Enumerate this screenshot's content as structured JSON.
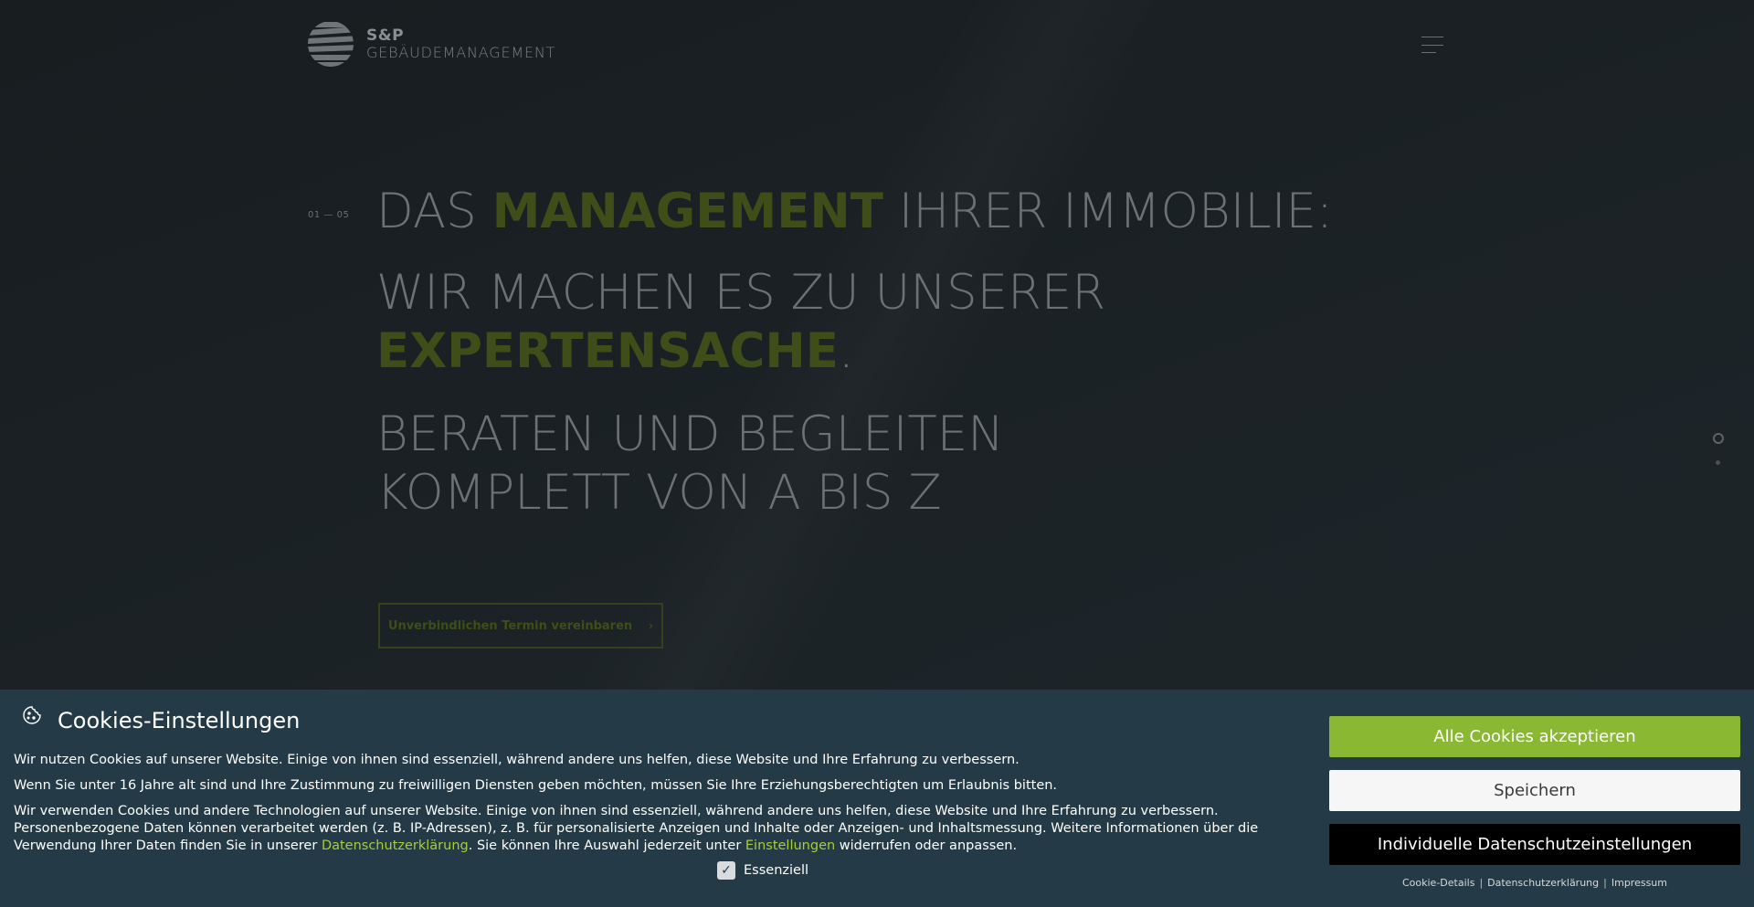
{
  "header": {
    "logo_line1": "S&P",
    "logo_line2": "GEBÄUDEMANAGEMENT",
    "menu_icon": "hamburger-icon"
  },
  "slide": {
    "counter": "01 — 05",
    "line1_pre": "DAS ",
    "line1_accent": "MANAGEMENT",
    "line1_post": " IHRER IMMOBILIE:",
    "line2": "WIR MACHEN ES ZU UNSERER",
    "line3_accent": "EXPERTENSACHE",
    "line3_post": ".",
    "line4": "BERATEN UND BEGLEITEN",
    "line5": "KOMPLETT VON A BIS Z",
    "cta_label": "Unverbindlichen Termin vereinbaren",
    "cta_icon": "chevron-right-icon"
  },
  "cookies": {
    "title": "Cookies-Einstellungen",
    "icon": "cookie-icon",
    "p1": "Wir nutzen Cookies auf unserer Website. Einige von ihnen sind essenziell, während andere uns helfen, diese Website und Ihre Erfahrung zu verbessern.",
    "p2": "Wenn Sie unter 16 Jahre alt sind und Ihre Zustimmung zu freiwilligen Diensten geben möchten, müssen Sie Ihre Erziehungsberechtigten um Erlaubnis bitten.",
    "p3_a": "Wir verwenden Cookies und andere Technologien auf unserer Website. Einige von ihnen sind essenziell, während andere uns helfen, diese Website und Ihre Erfahrung zu verbessern. Personenbezogene Daten können verarbeitet werden (z. B. IP-Adressen), z. B. für personalisierte Anzeigen und Inhalte oder Anzeigen- und Inhaltsmessung. Weitere Informationen über die Verwendung Ihrer Daten finden Sie in unserer ",
    "p3_link1": "Datenschutzerklärung",
    "p3_b": ". Sie können Ihre Auswahl jederzeit unter ",
    "p3_link2": "Einstellungen",
    "p3_c": " widerrufen oder anpassen.",
    "essential_label": "Essenziell",
    "essential_checked": true,
    "btn_accept": "Alle Cookies akzeptieren",
    "btn_save": "Speichern",
    "btn_individual": "Individuelle Datenschutzeinstellungen",
    "footer_link1": "Cookie-Details",
    "footer_link2": "Datenschutzerklärung",
    "footer_link3": "Impressum",
    "footer_sep": "|"
  },
  "colors": {
    "accent_green": "#8ab832",
    "link_green": "#a6ce39",
    "headline_accent": "#3e4e18",
    "banner_bg": "#243a46"
  }
}
